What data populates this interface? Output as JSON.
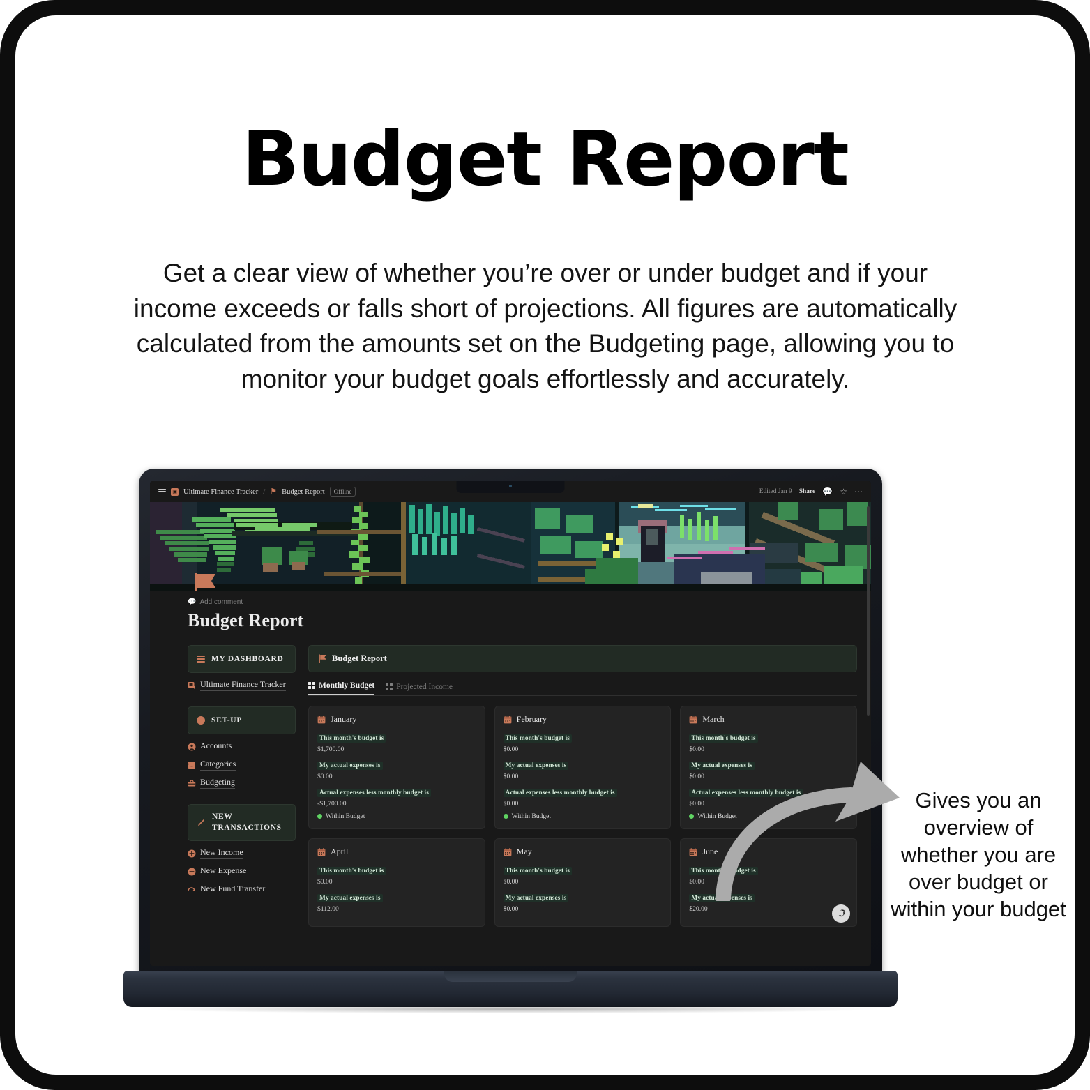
{
  "hero": {
    "title": "Budget Report",
    "description": "Get a clear view of whether you’re over or under budget and if your income exceeds or falls short of projections. All figures are automatically calculated from the amounts set on the Budgeting page, allowing you to monitor your budget goals effortlessly and accurately."
  },
  "annotation": {
    "text": "Gives you an overview of whether you are over budget or within your budget",
    "arrow_icon": "curved-arrow-icon",
    "arrow_color": "#ababab"
  },
  "app": {
    "topbar": {
      "menu_icon": "hamburger-icon",
      "workspace_icon": "page-icon",
      "workspace": "Ultimate Finance Tracker",
      "separator": "/",
      "page_icon": "flag-icon",
      "page": "Budget Report",
      "status_badge": "Offline",
      "edited": "Edited Jan 9",
      "share": "Share",
      "comment_icon": "comment-icon",
      "favorite_icon": "star-icon",
      "more_icon": "ellipsis-icon"
    },
    "cover": {
      "icon": "flag-icon",
      "alt": "pixel-art greenhouse jungle cover"
    },
    "add_comment": {
      "icon": "comment-icon",
      "label": "Add comment"
    },
    "doc_title": "Budget Report",
    "sidebar": {
      "groups": [
        {
          "card_icon": "list-icon",
          "card_label": "MY DASHBOARD",
          "items": [
            {
              "icon": "tracker-icon",
              "label": "Ultimate Finance Tracker"
            }
          ]
        },
        {
          "card_icon": "circle-icon",
          "card_label": "SET-UP",
          "items": [
            {
              "icon": "user-icon",
              "label": "Accounts"
            },
            {
              "icon": "drawer-icon",
              "label": "Categories"
            },
            {
              "icon": "briefcase-icon",
              "label": "Budgeting"
            }
          ]
        },
        {
          "card_icon": "pencil-icon",
          "card_label": "NEW TRANSACTIONS",
          "items": [
            {
              "icon": "plus-circle-icon",
              "label": "New Income"
            },
            {
              "icon": "minus-circle-icon",
              "label": "New Expense"
            },
            {
              "icon": "transfer-icon",
              "label": "New Fund Transfer"
            }
          ]
        }
      ]
    },
    "report": {
      "banner_icon": "flag-icon",
      "banner_title": "Budget Report",
      "tabs": [
        {
          "icon": "grid-icon",
          "label": "Monthly Budget",
          "active": true
        },
        {
          "icon": "grid-icon",
          "label": "Projected Income",
          "active": false
        }
      ],
      "labels": {
        "budget": "This month's budget is",
        "actual": "My actual expenses is",
        "difference": "Actual expenses less monthly budget is"
      },
      "cards": [
        {
          "month": "January",
          "icon": "calendar-icon",
          "budget": "$1,700.00",
          "actual": "$0.00",
          "difference": "-$1,700.00",
          "status": "Within Budget",
          "status_color": "#5fd362"
        },
        {
          "month": "February",
          "icon": "calendar-icon",
          "budget": "$0.00",
          "actual": "$0.00",
          "difference": "$0.00",
          "status": "Within Budget",
          "status_color": "#5fd362"
        },
        {
          "month": "March",
          "icon": "calendar-icon",
          "budget": "$0.00",
          "actual": "$0.00",
          "difference": "$0.00",
          "status": "Within Budget",
          "status_color": "#5fd362"
        },
        {
          "month": "April",
          "icon": "calendar-icon",
          "budget": "$0.00",
          "actual": "$112.00",
          "difference": "",
          "status": "",
          "status_color": "#5fd362"
        },
        {
          "month": "May",
          "icon": "calendar-icon",
          "budget": "$0.00",
          "actual": "$0.00",
          "difference": "",
          "status": "",
          "status_color": "#5fd362"
        },
        {
          "month": "June",
          "icon": "calendar-icon",
          "budget": "$0.00",
          "actual": "$20.00",
          "difference": "",
          "status": "",
          "status_color": "#5fd362"
        }
      ]
    },
    "helper_badge": "ℑ"
  },
  "theme": {
    "accent": "#c8795a",
    "card_green": "#222b24",
    "app_bg": "#191919",
    "frame": "#0d0d0d"
  }
}
